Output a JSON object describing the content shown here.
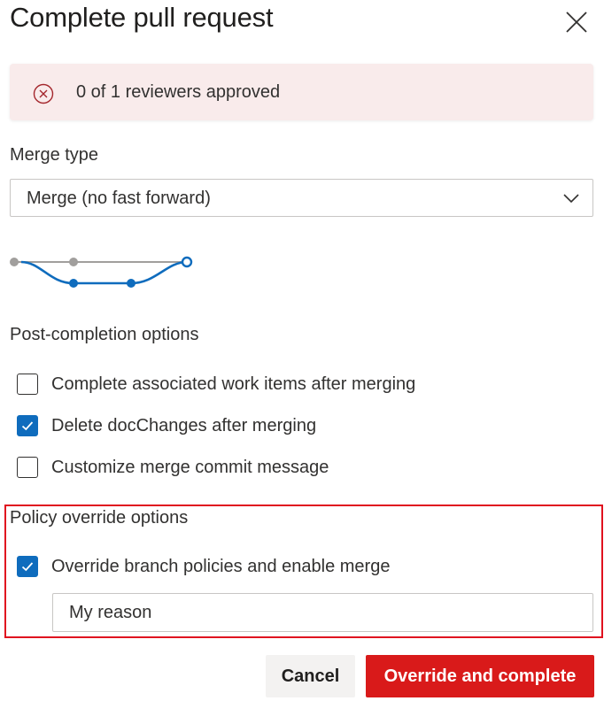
{
  "dialog": {
    "title": "Complete pull request",
    "close_icon": "close-icon"
  },
  "banner": {
    "icon": "error-circle-icon",
    "text": "0 of 1 reviewers approved",
    "background": "#f9ebeb",
    "icon_color": "#a4262c"
  },
  "merge_type": {
    "label": "Merge type",
    "selected": "Merge (no fast forward)",
    "chevron_icon": "chevron-down-icon"
  },
  "merge_diagram": {
    "icon": "merge-no-fast-forward-diagram",
    "branch_color": "#0f6cbd",
    "base_color": "#a19f9d"
  },
  "post_completion": {
    "label": "Post-completion options",
    "options": [
      {
        "label": "Complete associated work items after merging",
        "checked": false
      },
      {
        "label": "Delete docChanges after merging",
        "checked": true
      },
      {
        "label": "Customize merge commit message",
        "checked": false
      }
    ]
  },
  "policy_override": {
    "label": "Policy override options",
    "option": {
      "label": "Override branch policies and enable merge",
      "checked": true
    },
    "reason_value": "My reason",
    "highlight_color": "#e0111f"
  },
  "actions": {
    "cancel_label": "Cancel",
    "primary_label": "Override and complete",
    "primary_color": "#d91a1a"
  }
}
